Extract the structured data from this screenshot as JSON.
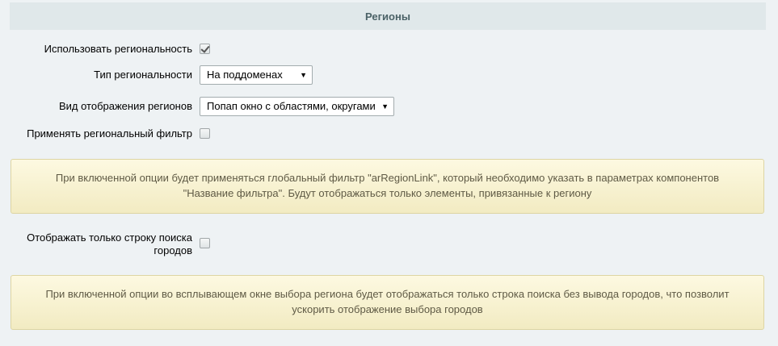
{
  "section": {
    "title": "Регионы"
  },
  "fields": {
    "use_regionality": {
      "label": "Использовать региональность",
      "checked": true
    },
    "regionality_type": {
      "label": "Тип региональности",
      "value": "На поддоменах"
    },
    "regions_view": {
      "label": "Вид отображения регионов",
      "value": "Попап окно с областями, округами"
    },
    "regional_filter": {
      "label": "Применять региональный фильтр",
      "checked": false
    },
    "search_only": {
      "label_line1": "Отображать только строку поиска",
      "label_line2": "городов",
      "checked": false
    }
  },
  "notes": {
    "filter_note_line1": "При включенной опции будет применяться глобальный фильтр \"arRegionLink\", который необходимо указать в параметрах компонентов",
    "filter_note_line2": "\"Название фильтра\". Будут отображаться только элементы, привязанные к региону",
    "search_note_line1": "При включенной опции во всплывающем окне выбора региона будет отображаться только строка поиска без вывода городов, что позволит",
    "search_note_line2": "ускорить отображение выбора городов"
  },
  "icons": {
    "dropdown": "triangle-down-icon",
    "check": "checkmark-icon"
  }
}
